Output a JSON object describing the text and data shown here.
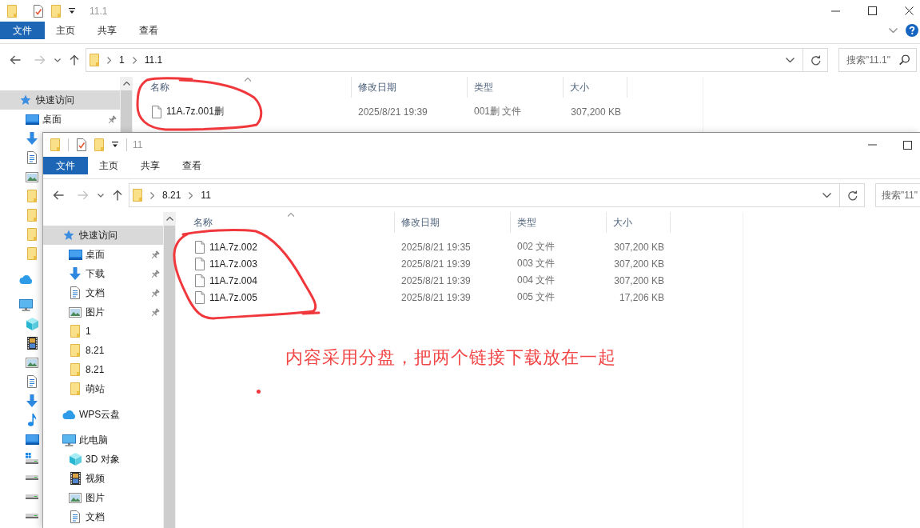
{
  "back_window": {
    "title": "11.1",
    "ribbon_tabs": [
      {
        "label": "文件",
        "kind": "file"
      },
      {
        "label": "主页",
        "kind": "tab"
      },
      {
        "label": "共享",
        "kind": "tab"
      },
      {
        "label": "查看",
        "kind": "tab"
      }
    ],
    "address": {
      "crumbs": [
        "1",
        "11.1"
      ]
    },
    "search": {
      "placeholder": "搜索\"11.1\""
    },
    "nav": [
      {
        "kind": "quick-access",
        "label": "快速访问",
        "selected": true,
        "children": [
          {
            "kind": "desktop",
            "label": "桌面",
            "selected": false,
            "pinned": true
          },
          {
            "kind": "downloads"
          },
          {
            "kind": "documents"
          },
          {
            "kind": "pictures"
          },
          {
            "kind": "folder"
          },
          {
            "kind": "folder"
          },
          {
            "kind": "folder"
          },
          {
            "kind": "folder"
          }
        ]
      },
      {
        "kind": "cloud"
      },
      {
        "kind": "pc",
        "children": [
          {
            "kind": "objects-3d"
          },
          {
            "kind": "videos"
          },
          {
            "kind": "pictures"
          },
          {
            "kind": "documents"
          },
          {
            "kind": "downloads"
          },
          {
            "kind": "music"
          },
          {
            "kind": "desktop"
          },
          {
            "kind": "system-drive"
          },
          {
            "kind": "drive"
          },
          {
            "kind": "drive"
          },
          {
            "kind": "drive"
          }
        ]
      }
    ],
    "columns": [
      {
        "label": "名称",
        "sorted": true
      },
      {
        "label": "修改日期",
        "sorted": false
      },
      {
        "label": "类型",
        "sorted": false
      },
      {
        "label": "大小",
        "sorted": false
      }
    ],
    "files": [
      {
        "name": "11A.7z.001删",
        "modified": "2025/8/21 19:39",
        "type": "001删 文件",
        "size": "307,200 KB"
      }
    ]
  },
  "front_window": {
    "title": "11",
    "ribbon_tabs": [
      {
        "label": "文件",
        "kind": "file"
      },
      {
        "label": "主页",
        "kind": "tab"
      },
      {
        "label": "共享",
        "kind": "tab"
      },
      {
        "label": "查看",
        "kind": "tab"
      }
    ],
    "address": {
      "crumbs": [
        "8.21",
        "11"
      ]
    },
    "search": {
      "placeholder": "搜索\"11\""
    },
    "nav": [
      {
        "kind": "quick-access",
        "label": "快速访问",
        "selected": true,
        "children": [
          {
            "kind": "desktop",
            "label": "桌面",
            "selected": false,
            "pinned": true
          },
          {
            "kind": "downloads",
            "label": "下载",
            "selected": false,
            "pinned": true
          },
          {
            "kind": "documents",
            "label": "文档",
            "selected": false,
            "pinned": true
          },
          {
            "kind": "pictures",
            "label": "图片",
            "selected": false,
            "pinned": true
          },
          {
            "kind": "folder",
            "label": "1",
            "selected": false,
            "pinned": false
          },
          {
            "kind": "folder",
            "label": "8.21",
            "selected": false,
            "pinned": false
          },
          {
            "kind": "folder",
            "label": "8.21",
            "selected": false,
            "pinned": false
          },
          {
            "kind": "folder",
            "label": "萌站",
            "selected": false,
            "pinned": false
          }
        ]
      },
      {
        "kind": "cloud",
        "label": "WPS云盘",
        "selected": false
      },
      {
        "kind": "pc",
        "label": "此电脑",
        "selected": false,
        "children": [
          {
            "kind": "objects-3d",
            "label": "3D 对象",
            "selected": false
          },
          {
            "kind": "videos",
            "label": "视频",
            "selected": false
          },
          {
            "kind": "pictures",
            "label": "图片",
            "selected": false
          },
          {
            "kind": "documents",
            "label": "文档",
            "selected": false
          }
        ]
      }
    ],
    "columns": [
      {
        "label": "名称",
        "sorted": true
      },
      {
        "label": "修改日期",
        "sorted": false
      },
      {
        "label": "类型",
        "sorted": false
      },
      {
        "label": "大小",
        "sorted": false
      }
    ],
    "files": [
      {
        "name": "11A.7z.002",
        "modified": "2025/8/21 19:35",
        "type": "002 文件",
        "size": "307,200 KB"
      },
      {
        "name": "11A.7z.003",
        "modified": "2025/8/21 19:39",
        "type": "003 文件",
        "size": "307,200 KB"
      },
      {
        "name": "11A.7z.004",
        "modified": "2025/8/21 19:39",
        "type": "004 文件",
        "size": "307,200 KB"
      },
      {
        "name": "11A.7z.005",
        "modified": "2025/8/21 19:39",
        "type": "005 文件",
        "size": "17,206 KB"
      }
    ]
  },
  "note": "内容采用分盘，把两个链接下载放在一起"
}
